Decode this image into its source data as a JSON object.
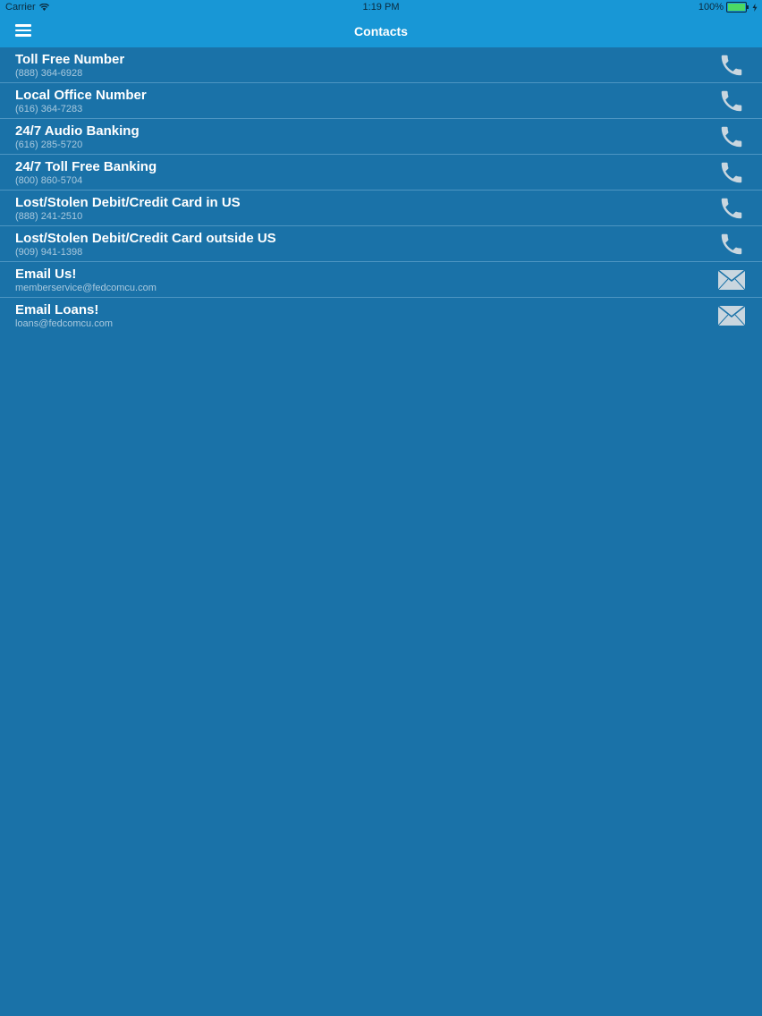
{
  "status_bar": {
    "carrier": "Carrier",
    "time": "1:19 PM",
    "battery": "100%",
    "battery_color": "#4cd964"
  },
  "navbar": {
    "title": "Contacts",
    "menu_icon": "hamburger-menu-icon"
  },
  "contacts": [
    {
      "name": "Toll Free Number",
      "detail": "(888) 364-6928",
      "icon": "phone-icon"
    },
    {
      "name": "Local Office Number",
      "detail": "(616) 364-7283",
      "icon": "phone-icon"
    },
    {
      "name": "24/7 Audio Banking",
      "detail": "(616) 285-5720",
      "icon": "phone-icon"
    },
    {
      "name": "24/7 Toll Free Banking",
      "detail": "(800) 860-5704",
      "icon": "phone-icon"
    },
    {
      "name": "Lost/Stolen Debit/Credit Card in US",
      "detail": "(888) 241-2510",
      "icon": "phone-icon"
    },
    {
      "name": "Lost/Stolen Debit/Credit Card outside US",
      "detail": "(909) 941-1398",
      "icon": "phone-icon"
    },
    {
      "name": "Email Us!",
      "detail": "memberservice@fedcomcu.com",
      "icon": "envelope-icon"
    },
    {
      "name": "Email Loans!",
      "detail": "loans@fedcomcu.com",
      "icon": "envelope-icon"
    }
  ],
  "colors": {
    "background": "#1a72a8",
    "navbar": "#1897d6",
    "icon": "#c9d6df"
  }
}
